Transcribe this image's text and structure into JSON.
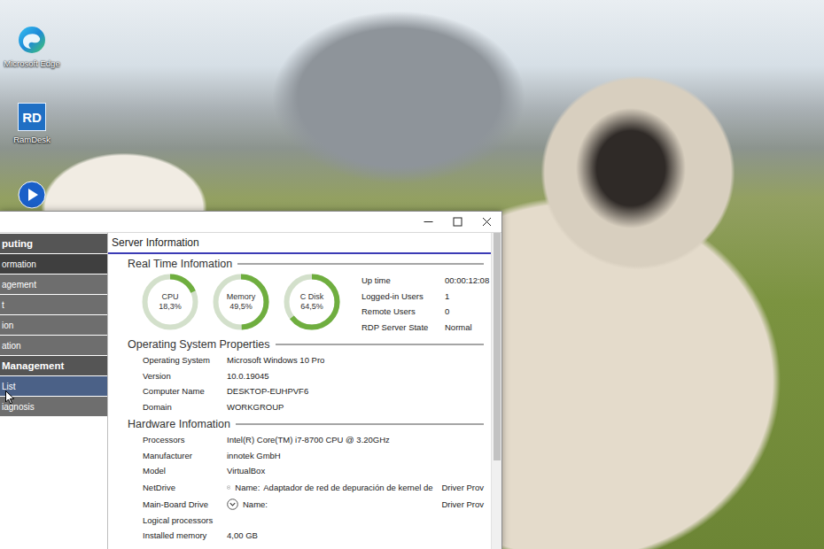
{
  "desktop": {
    "icons": [
      {
        "kind": "edge",
        "label": "Microsoft Edge"
      },
      {
        "kind": "ramdesk",
        "label": "RamDesk",
        "glyph": "RD"
      },
      {
        "kind": "player"
      }
    ]
  },
  "window": {
    "sidebar": {
      "items": [
        {
          "kind": "header",
          "label": "puting",
          "selected": false,
          "hovered": false
        },
        {
          "kind": "item",
          "label": "ormation",
          "selected": true,
          "hovered": false
        },
        {
          "kind": "item",
          "label": "agement",
          "selected": false,
          "hovered": false
        },
        {
          "kind": "item",
          "label": "t",
          "selected": false,
          "hovered": false
        },
        {
          "kind": "item",
          "label": "ion",
          "selected": false,
          "hovered": false
        },
        {
          "kind": "item",
          "label": "ation",
          "selected": false,
          "hovered": false
        },
        {
          "kind": "header",
          "label": "Management",
          "selected": false,
          "hovered": false
        },
        {
          "kind": "item",
          "label": "List",
          "selected": false,
          "hovered": true
        },
        {
          "kind": "item",
          "label": "iagnosis",
          "selected": false,
          "hovered": false
        }
      ]
    },
    "page_title": "Server Information",
    "realtime": {
      "title": "Real Time Infomation",
      "gauges": [
        {
          "label": "CPU",
          "reading": "18,3%",
          "level": 0.183
        },
        {
          "label": "Memory",
          "reading": "49,5%",
          "level": 0.495
        },
        {
          "label": "C Disk",
          "reading": "64,5%",
          "level": 0.645
        }
      ],
      "stats": [
        {
          "label": "Up time",
          "value": "00:00:12:08"
        },
        {
          "label": "Logged-in Users",
          "value": "1"
        },
        {
          "label": "Remote Users",
          "value": "0"
        },
        {
          "label": "RDP Server State",
          "value": "Normal"
        }
      ]
    },
    "os": {
      "title": "Operating System Properties",
      "rows": [
        {
          "kind": "text",
          "label": "Operating System",
          "value": "Microsoft Windows 10 Pro"
        },
        {
          "kind": "text",
          "label": "Version",
          "value": "10.0.19045"
        },
        {
          "kind": "text",
          "label": "Computer Name",
          "value": "DESKTOP-EUHPVF6"
        },
        {
          "kind": "text",
          "label": "Domain",
          "value": "WORKGROUP"
        }
      ]
    },
    "hardware": {
      "title": "Hardware Infomation",
      "rows": [
        {
          "kind": "text",
          "label": "Processors",
          "value": "Intel(R) Core(TM) i7-8700 CPU @ 3.20GHz"
        },
        {
          "kind": "text",
          "label": "Manufacturer",
          "value": "innotek GmbH"
        },
        {
          "kind": "text",
          "label": "Model",
          "value": "VirtualBox"
        },
        {
          "kind": "expand",
          "label": "NetDrive",
          "expanded": false,
          "name_label": "Name:",
          "name": "Adaptador de red de depuración de kernel de",
          "provider": "Driver Prov"
        },
        {
          "kind": "expand",
          "label": "Main-Board Drive",
          "expanded": false,
          "name_label": "Name:",
          "provider": "Driver Prov"
        },
        {
          "kind": "text",
          "label": "Logical processors"
        },
        {
          "kind": "text",
          "label": "Installed memory",
          "value": "4,00 GB"
        }
      ]
    },
    "scrollbar": {
      "level": 0.72
    }
  }
}
